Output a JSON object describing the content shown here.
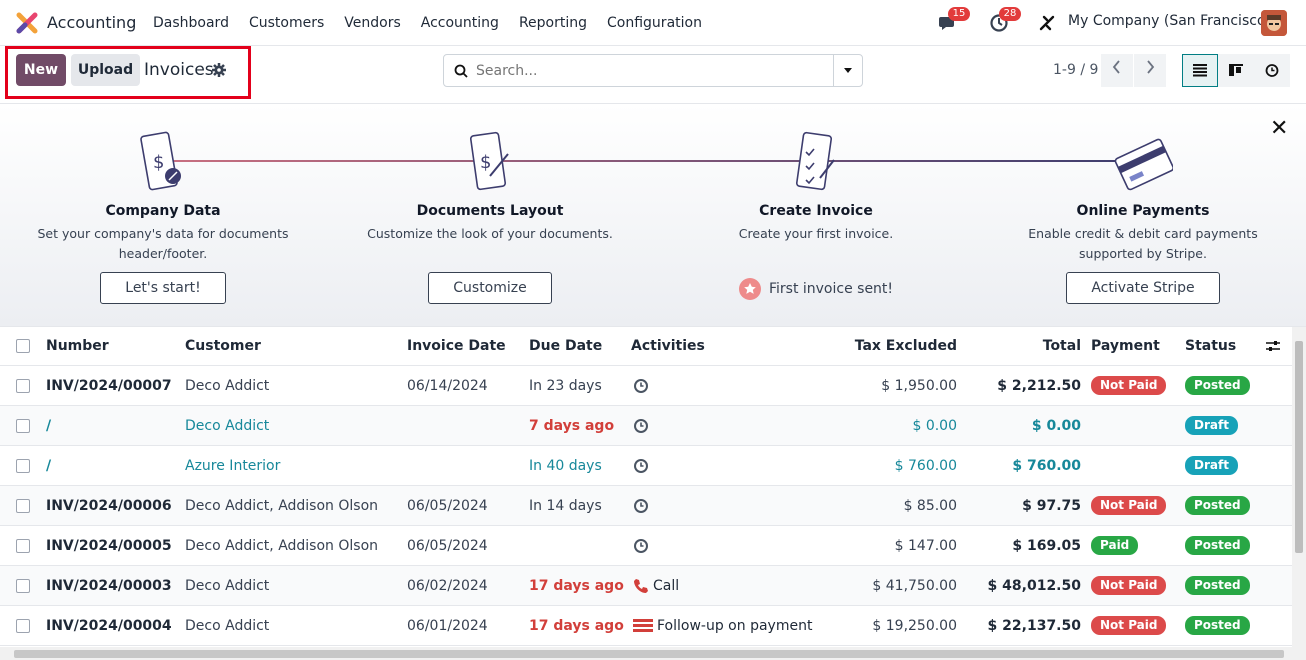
{
  "app": {
    "name": "Accounting",
    "menu": [
      "Dashboard",
      "Customers",
      "Vendors",
      "Accounting",
      "Reporting",
      "Configuration"
    ]
  },
  "systray": {
    "messages_count": "15",
    "activities_count": "28",
    "company": "My Company (San Francisco)"
  },
  "control": {
    "new_label": "New",
    "upload_label": "Upload",
    "breadcrumb": "Invoices",
    "search_placeholder": "Search...",
    "pager": "1-9 / 9"
  },
  "onboarding": {
    "steps": [
      {
        "title": "Company Data",
        "desc": "Set your company's data for documents header/footer.",
        "button": "Let's start!"
      },
      {
        "title": "Documents Layout",
        "desc": "Customize the look of your documents.",
        "button": "Customize"
      },
      {
        "title": "Create Invoice",
        "desc": "Create your first invoice.",
        "done_label": "First invoice sent!"
      },
      {
        "title": "Online Payments",
        "desc": "Enable credit & debit card payments supported by Stripe.",
        "button": "Activate Stripe"
      }
    ]
  },
  "table": {
    "headers": {
      "number": "Number",
      "customer": "Customer",
      "invoice_date": "Invoice Date",
      "due_date": "Due Date",
      "activities": "Activities",
      "tax_excluded": "Tax Excluded",
      "total": "Total",
      "payment": "Payment",
      "status": "Status"
    },
    "rows": [
      {
        "number": "INV/2024/00007",
        "customer": "Deco Addict",
        "invoice_date": "06/14/2024",
        "due_date": "In 23 days",
        "activity": "",
        "tax_excluded": "$ 1,950.00",
        "total": "$ 2,212.50",
        "payment": "Not Paid",
        "status": "Posted"
      },
      {
        "number": "/",
        "customer": "Deco Addict",
        "invoice_date": "",
        "due_date": "7 days ago",
        "activity": "",
        "tax_excluded": "$ 0.00",
        "total": "$ 0.00",
        "payment": "",
        "status": "Draft"
      },
      {
        "number": "/",
        "customer": "Azure Interior",
        "invoice_date": "",
        "due_date": "In 40 days",
        "activity": "",
        "tax_excluded": "$ 760.00",
        "total": "$ 760.00",
        "payment": "",
        "status": "Draft"
      },
      {
        "number": "INV/2024/00006",
        "customer": "Deco Addict, Addison Olson",
        "invoice_date": "06/05/2024",
        "due_date": "In 14 days",
        "activity": "",
        "tax_excluded": "$ 85.00",
        "total": "$ 97.75",
        "payment": "Not Paid",
        "status": "Posted"
      },
      {
        "number": "INV/2024/00005",
        "customer": "Deco Addict, Addison Olson",
        "invoice_date": "06/05/2024",
        "due_date": "",
        "activity": "",
        "tax_excluded": "$ 147.00",
        "total": "$ 169.05",
        "payment": "Paid",
        "status": "Posted"
      },
      {
        "number": "INV/2024/00003",
        "customer": "Deco Addict",
        "invoice_date": "06/02/2024",
        "due_date": "17 days ago",
        "activity": "Call",
        "tax_excluded": "$ 41,750.00",
        "total": "$ 48,012.50",
        "payment": "Not Paid",
        "status": "Posted"
      },
      {
        "number": "INV/2024/00004",
        "customer": "Deco Addict",
        "invoice_date": "06/01/2024",
        "due_date": "17 days ago",
        "activity": "Follow-up on payment",
        "tax_excluded": "$ 19,250.00",
        "total": "$ 22,137.50",
        "payment": "Not Paid",
        "status": "Posted"
      }
    ]
  },
  "colors": {
    "brand": "#714b67",
    "link": "#17889a",
    "overdue": "#d23f3a",
    "highlight_box": "#e3001b"
  }
}
